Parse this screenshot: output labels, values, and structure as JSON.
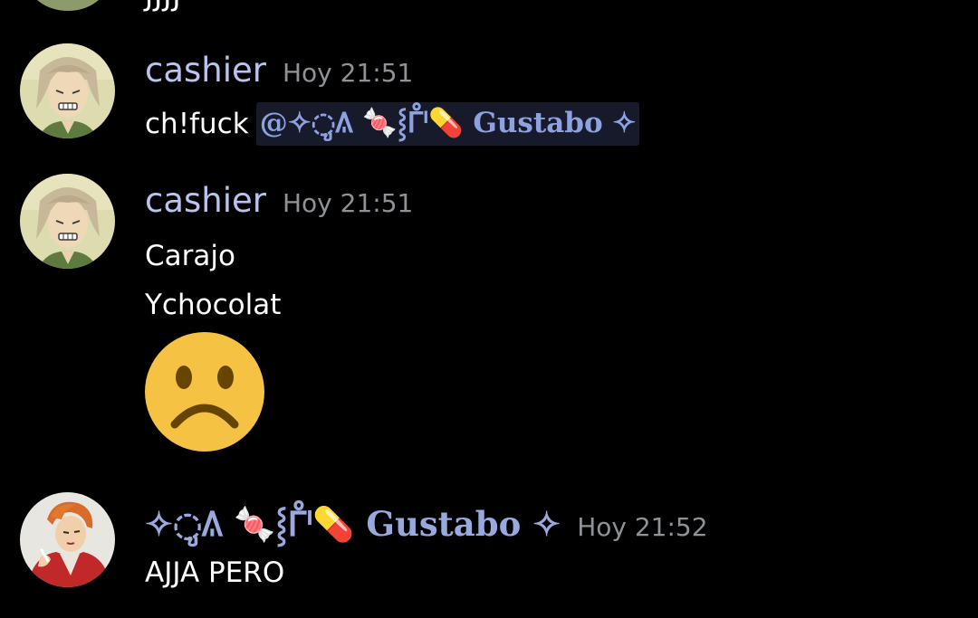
{
  "colors": {
    "background": "#000000",
    "username": "#b9c3ee",
    "timestamp": "#8e9297",
    "mention_bg": "#171a2b",
    "mention_text": "#8ea1e1"
  },
  "previous_message": {
    "text": "JJJJ"
  },
  "messages": [
    {
      "author": "cashier",
      "time": "Hoy 21:51",
      "avatar_icon": "anime-avatar-icon",
      "lines": [
        {
          "text": "ch!fuck",
          "mention": "@✧◌ູ𐒱 🍬⸾ᒤᑊ💊 Gustabo ✧"
        }
      ]
    },
    {
      "author": "cashier",
      "time": "Hoy 21:51",
      "avatar_icon": "anime-avatar-icon",
      "lines": [
        {
          "text": "Carajo"
        },
        {
          "text": "Ychocolat"
        }
      ],
      "emoji": "slightly-frowning-face-emoji"
    },
    {
      "author": "✧◌ູ𐒱 🍬⸾ᒤᑊ💊 Gustabo ✧",
      "time": "Hoy 21:52",
      "avatar_icon": "red-jacket-avatar-icon",
      "lines": [
        {
          "text": "AJJA PERO"
        }
      ]
    }
  ]
}
